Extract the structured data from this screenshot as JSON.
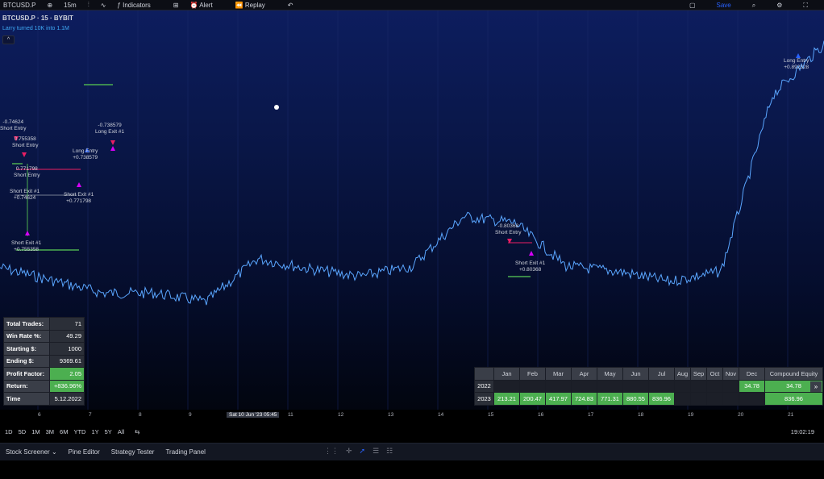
{
  "topbar": {
    "symbol": "BTCUSD.P",
    "interval": "15m",
    "indicators": "Indicators",
    "alert": "Alert",
    "replay": "Replay",
    "save_label": "Save"
  },
  "legend": {
    "title": "BTCUSD.P · 15 · BYBIT",
    "indicator": "Larry turned 10K into 1.1M",
    "collapse": "^"
  },
  "trade_labels": [
    {
      "text": "-0.74624\nShort Entry"
    },
    {
      "text": "0.755358\nShort Entry"
    },
    {
      "text": "-0.738579\nLong Exit #1"
    },
    {
      "text": "Long Entry\n+0.738579"
    },
    {
      "text": "0.771798\nShort Entry"
    },
    {
      "text": "Short Exit #1\n+0.74624"
    },
    {
      "text": "Short Exit #1\n+0.771798"
    },
    {
      "text": "Short Exit #1\n+0.755358"
    },
    {
      "text": "-0.80368\nShort Entry"
    },
    {
      "text": "Short Exit #1\n+0.80368"
    },
    {
      "text": "Long Entry\n+0.892328"
    }
  ],
  "stats": [
    {
      "label": "Total Trades:",
      "value": "71",
      "positive": false
    },
    {
      "label": "Win Rate %:",
      "value": "49.29",
      "positive": false
    },
    {
      "label": "Starting $:",
      "value": "1000",
      "positive": false
    },
    {
      "label": "Ending $:",
      "value": "9369.61",
      "positive": false
    },
    {
      "label": "Profit Factor:",
      "value": "2.05",
      "positive": true
    },
    {
      "label": "Return:",
      "value": "+836.96%",
      "positive": true
    },
    {
      "label": "Time",
      "value": "5.12.2022",
      "positive": false
    }
  ],
  "monthly": {
    "headers": [
      "",
      "Jan",
      "Feb",
      "Mar",
      "Apr",
      "May",
      "Jun",
      "Jul",
      "Aug",
      "Sep",
      "Oct",
      "Nov",
      "Dec",
      "Compound Equity"
    ],
    "rows": [
      {
        "year": "2022",
        "cells": [
          "",
          "",
          "",
          "",
          "",
          "",
          "",
          "",
          "",
          "",
          "",
          "34.78"
        ],
        "equity": "34.78"
      },
      {
        "year": "2023",
        "cells": [
          "213.21",
          "200.47",
          "417.97",
          "724.83",
          "771.31",
          "880.55",
          "836.96",
          "",
          "",
          "",
          "",
          ""
        ],
        "equity": "836.96"
      }
    ],
    "next": "»"
  },
  "time_axis": {
    "ticks": [
      "6",
      "7",
      "8",
      "9",
      "11",
      "12",
      "13",
      "14",
      "15",
      "16",
      "17",
      "18",
      "19",
      "20",
      "21"
    ],
    "crosshair": "Sat 10 Jun '23   05:45"
  },
  "range_bar": {
    "ranges": [
      "1D",
      "5D",
      "1M",
      "3M",
      "6M",
      "YTD",
      "1Y",
      "5Y",
      "All"
    ],
    "clock": "19:02:19"
  },
  "bottom_tabs": [
    "Stock Screener",
    "Pine Editor",
    "Strategy Tester",
    "Trading Panel"
  ],
  "chart_data": {
    "type": "line",
    "x": [
      "6",
      "7",
      "8",
      "9",
      "10",
      "11",
      "12",
      "13",
      "14",
      "15",
      "16",
      "17",
      "18",
      "19",
      "20",
      "21"
    ],
    "series": [
      {
        "values": [
          0.755,
          0.745,
          0.735,
          0.735,
          0.728,
          0.762,
          0.754,
          0.748,
          0.756,
          0.795,
          0.79,
          0.756,
          0.752,
          0.744,
          0.752,
          0.89,
          0.93
        ]
      }
    ],
    "ylim": [
      0.7,
      0.95
    ],
    "colors": {
      "price": "#5aa6ff",
      "long": "#2962ff",
      "short": "#e91e63",
      "exit": "#d500f9",
      "level": "#4caf50"
    }
  }
}
